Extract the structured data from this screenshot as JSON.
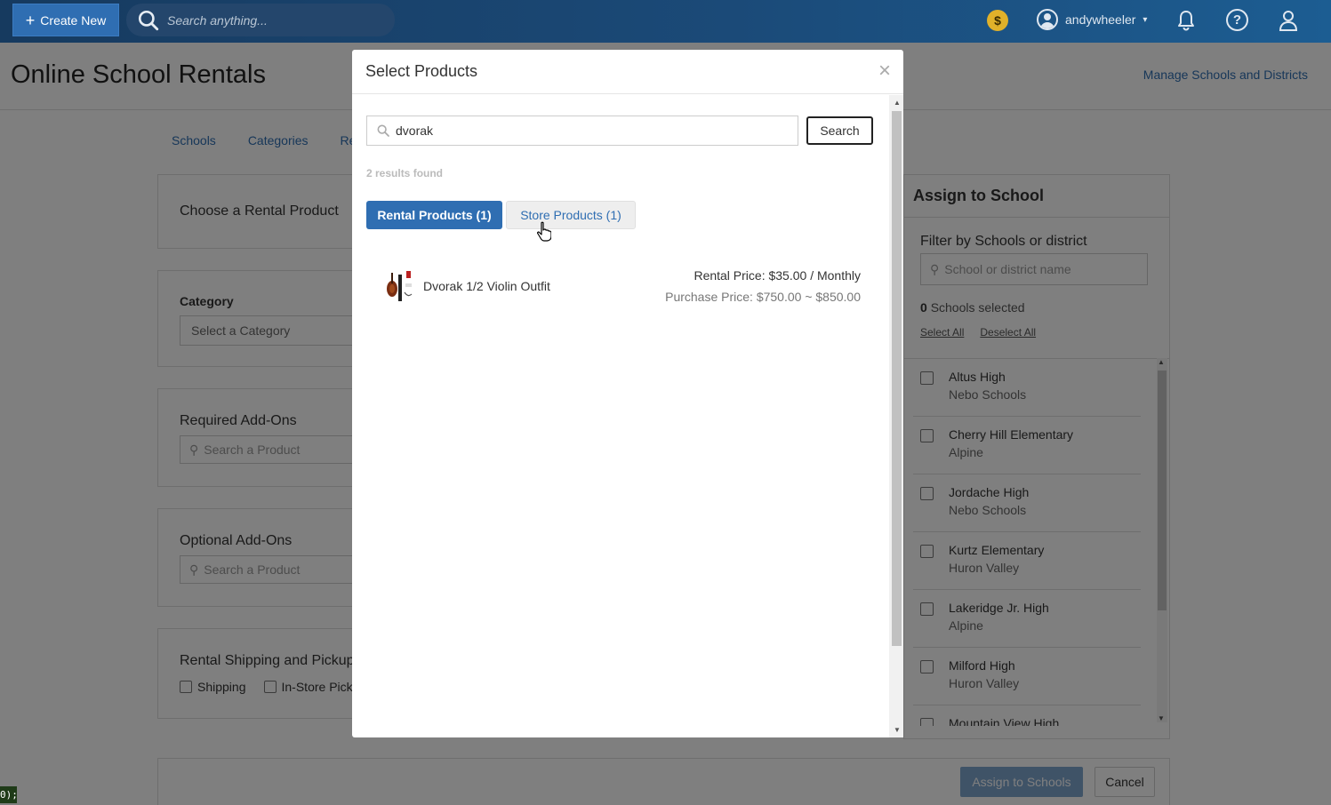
{
  "topbar": {
    "create_label": "Create New",
    "search_placeholder": "Search anything...",
    "coin_symbol": "$",
    "username": "andywheeler",
    "help_symbol": "?"
  },
  "page": {
    "title": "Online School Rentals",
    "manage_link": "Manage Schools and Districts",
    "tabs": [
      "Schools",
      "Categories",
      "Re"
    ],
    "choose_title": "Choose a Rental Product",
    "category_label": "Category",
    "category_placeholder": "Select a Category",
    "required_title": "Required Add-Ons",
    "optional_title": "Optional Add-Ons",
    "addon_placeholder": "Search a Product",
    "shipping_title": "Rental Shipping and Pickup",
    "shipping_option": "Shipping",
    "instore_option": "In-Store Picku"
  },
  "assign": {
    "title": "Assign to School",
    "filter_label": "Filter by Schools or district",
    "filter_placeholder": "School or district name",
    "selected_count": "0",
    "selected_suffix": "Schools selected",
    "select_all": "Select All",
    "deselect_all": "Deselect All",
    "schools": [
      {
        "name": "Altus High",
        "district": "Nebo Schools"
      },
      {
        "name": "Cherry Hill Elementary",
        "district": "Alpine"
      },
      {
        "name": "Jordache High",
        "district": "Nebo Schools"
      },
      {
        "name": "Kurtz Elementary",
        "district": "Huron Valley"
      },
      {
        "name": "Lakeridge Jr. High",
        "district": "Alpine"
      },
      {
        "name": "Milford High",
        "district": "Huron Valley"
      },
      {
        "name": "Mountain View High",
        "district": ""
      }
    ],
    "assign_button": "Assign to Schools",
    "cancel_button": "Cancel"
  },
  "modal": {
    "title": "Select Products",
    "close_symbol": "×",
    "search_value": "dvorak",
    "search_button": "Search",
    "results_found": "2 results found",
    "tab_rental": "Rental Products (1)",
    "tab_store": "Store Products (1)",
    "product": {
      "name": "Dvorak 1/2 Violin Outfit",
      "rental_price": "Rental Price: $35.00 / Monthly",
      "purchase_price": "Purchase Price: $750.00 ~ $850.00"
    }
  },
  "console_text": "0);",
  "colors": {
    "accent": "#2f6eb2",
    "topbar": "#1b4a78",
    "coin": "#e0b12a"
  }
}
